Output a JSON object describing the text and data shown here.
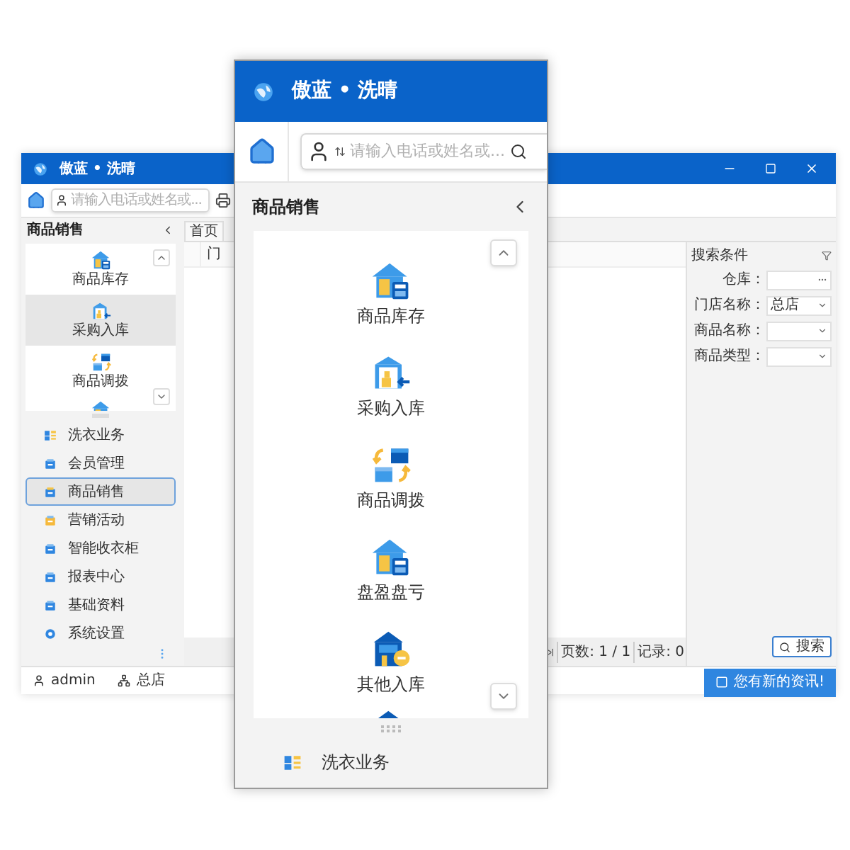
{
  "background_window": {
    "title": "傲蓝 • 洗晴",
    "search": {
      "placeholder": "请输入电话或姓名或..."
    },
    "sidebar": {
      "title": "商品销售",
      "shortcuts": [
        {
          "label": "商品库存",
          "selected": false
        },
        {
          "label": "采购入库",
          "selected": true
        },
        {
          "label": "商品调拨",
          "selected": false
        }
      ],
      "nav": [
        {
          "label": "洗衣业务",
          "selected": false
        },
        {
          "label": "会员管理",
          "selected": false
        },
        {
          "label": "商品销售",
          "selected": true
        },
        {
          "label": "营销活动",
          "selected": false
        },
        {
          "label": "智能收衣柜",
          "selected": false
        },
        {
          "label": "报表中心",
          "selected": false
        },
        {
          "label": "基础资料",
          "selected": false
        },
        {
          "label": "系统设置",
          "selected": false
        }
      ]
    },
    "tabs": [
      {
        "label": "首页"
      }
    ],
    "table": {
      "columns": [
        "门"
      ]
    },
    "pager": {
      "pages": "页数: 1 / 1",
      "records": "记录: 0"
    },
    "search_panel": {
      "title": "搜索条件",
      "fields": [
        {
          "label": "仓库：",
          "kind": "picker"
        },
        {
          "label": "门店名称：",
          "kind": "select",
          "value": "总店"
        },
        {
          "label": "商品名称：",
          "kind": "select"
        },
        {
          "label": "商品类型：",
          "kind": "select"
        }
      ],
      "button": "搜索"
    },
    "status_bar": {
      "user": "admin",
      "store": "总店",
      "notice": "您有新的资讯!"
    }
  },
  "zoomed_panel": {
    "title": "傲蓝 • 洗晴",
    "search": {
      "placeholder": "请输入电话或姓名或..."
    },
    "section": "商品销售",
    "shortcuts": [
      {
        "label": "商品库存"
      },
      {
        "label": "采购入库"
      },
      {
        "label": "商品调拨"
      },
      {
        "label": "盘盈盘亏"
      },
      {
        "label": "其他入库"
      }
    ],
    "nav": [
      {
        "label": "洗衣业务"
      }
    ]
  }
}
